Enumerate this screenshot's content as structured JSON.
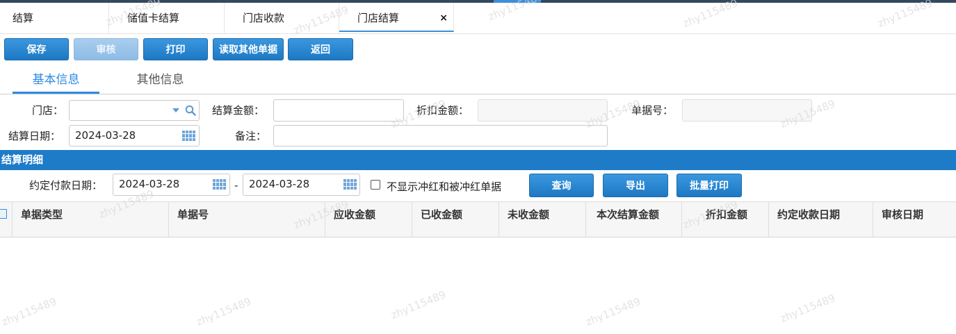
{
  "tabs": [
    {
      "label": "结算"
    },
    {
      "label": "储值卡结算"
    },
    {
      "label": "门店收款"
    },
    {
      "label": "门店结算",
      "close": "×"
    }
  ],
  "toolbar": {
    "save": "保存",
    "audit": "审核",
    "print": "打印",
    "read_other": "读取其他单据",
    "back": "返回"
  },
  "subtabs": {
    "basic": "基本信息",
    "other": "其他信息"
  },
  "form": {
    "store_label": "门店：",
    "store_value": "",
    "amount_label": "结算金额：",
    "amount_value": "",
    "discount_label": "折扣金额：",
    "discount_value": "",
    "docno_label": "单据号：",
    "docno_value": "",
    "date_label": "结算日期：",
    "date_value": "2024-03-28",
    "remark_label": "备注：",
    "remark_value": ""
  },
  "section_title": "结算明细",
  "filter": {
    "due_label": "约定付款日期：",
    "from_date": "2024-03-28",
    "dash": "-",
    "to_date": "2024-03-28",
    "hide_red_label": "不显示冲红和被冲红单据",
    "query": "查询",
    "export": "导出",
    "batch_print": "批量打印"
  },
  "table": {
    "columns": [
      "单据类型",
      "单据号",
      "应收金额",
      "已收金额",
      "未收金额",
      "本次结算金额",
      "折扣金额",
      "约定收款日期",
      "审核日期"
    ]
  },
  "colors": {
    "accent": "#1e7bc8",
    "button": "#2a86d1",
    "topbar": "#34495e"
  },
  "icons": {
    "search": "search-icon",
    "dropdown": "chevron-down-icon",
    "calendar": "calendar-icon",
    "close": "close-icon"
  }
}
